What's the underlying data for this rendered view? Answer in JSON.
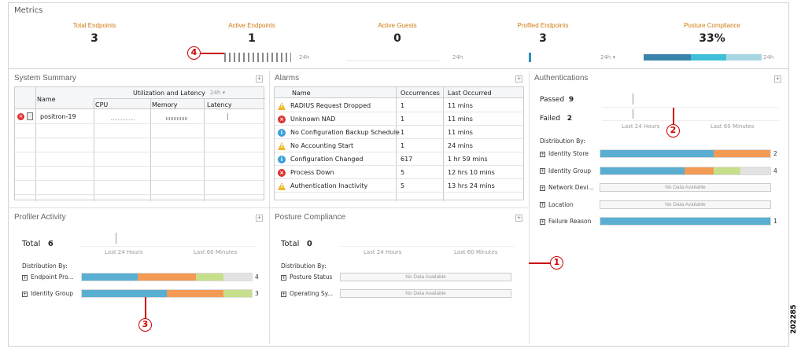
{
  "metrics": {
    "title": "Metrics",
    "items": [
      {
        "label": "Total Endpoints",
        "value": "3"
      },
      {
        "label": "Active Endpoints",
        "value": "1"
      },
      {
        "label": "Active Guests",
        "value": "0"
      },
      {
        "label": "Profiled Endpoints",
        "value": "3"
      },
      {
        "label": "Posture Compliance",
        "value": "33%"
      }
    ],
    "period_labels": [
      "24h",
      "24h",
      "24h ▾",
      "24h"
    ]
  },
  "system_summary": {
    "title": "System Summary",
    "group_header": "Utilization and Latency",
    "period": "24h ▾",
    "columns": [
      "Name",
      "CPU",
      "Memory",
      "Latency"
    ],
    "rows": [
      {
        "name": "positron-19"
      }
    ]
  },
  "alarms": {
    "title": "Alarms",
    "columns": [
      "Name",
      "Occurrences",
      "Last Occurred"
    ],
    "rows": [
      {
        "icon": "warning-icon",
        "name": "RADIUS Request Dropped",
        "occ": "1",
        "last": "11 mins"
      },
      {
        "icon": "error-icon",
        "name": "Unknown NAD",
        "occ": "1",
        "last": "11 mins"
      },
      {
        "icon": "info-icon",
        "name": "No Configuration Backup Schedule",
        "occ": "1",
        "last": "11 mins"
      },
      {
        "icon": "warning-icon",
        "name": "No Accounting Start",
        "occ": "1",
        "last": "24 mins"
      },
      {
        "icon": "info-icon",
        "name": "Configuration Changed",
        "occ": "617",
        "last": "1 hr 59 mins"
      },
      {
        "icon": "error-icon",
        "name": "Process Down",
        "occ": "5",
        "last": "12 hrs 10 mins"
      },
      {
        "icon": "warning-icon",
        "name": "Authentication Inactivity",
        "occ": "5",
        "last": "13 hrs 24 mins"
      }
    ]
  },
  "authentications": {
    "title": "Authentications",
    "passed_label": "Passed",
    "passed": "9",
    "failed_label": "Failed",
    "failed": "2",
    "last24": "Last 24 Hours",
    "last60": "Last 60 Minutes",
    "dist_by": "Distribution By:",
    "items": [
      {
        "label": "Identity Store",
        "count": "2"
      },
      {
        "label": "Identity Group",
        "count": "4"
      },
      {
        "label": "Network Devi...",
        "nodata": "No Data Available"
      },
      {
        "label": "Location",
        "nodata": "No Data Available"
      },
      {
        "label": "Failure Reason",
        "count": "1"
      }
    ]
  },
  "profiler": {
    "title": "Profiler Activity",
    "total_label": "Total",
    "total": "6",
    "last24": "Last 24 Hours",
    "last60": "Last 60 Minutes",
    "dist_by": "Distribution By:",
    "items": [
      {
        "label": "Endpoint Pro...",
        "count": "4"
      },
      {
        "label": "Identity Group",
        "count": "3"
      }
    ]
  },
  "posture": {
    "title": "Posture Compliance",
    "total_label": "Total",
    "total": "0",
    "last24": "Last 24 Hours",
    "last60": "Last 60 Minutes",
    "dist_by": "Distribution By:",
    "items": [
      {
        "label": "Posture Status",
        "nodata": "No Data Available"
      },
      {
        "label": "Operating Sy...",
        "nodata": "No Data Available"
      }
    ]
  },
  "callouts": [
    "1",
    "2",
    "3",
    "4"
  ],
  "side_text": "202285",
  "colors": {
    "blue": "#5aaed1",
    "orange": "#f39a55",
    "green": "#c6df8a",
    "gray": "#e2e2e2",
    "accent": "#d07a10",
    "callout": "#cc0000"
  }
}
